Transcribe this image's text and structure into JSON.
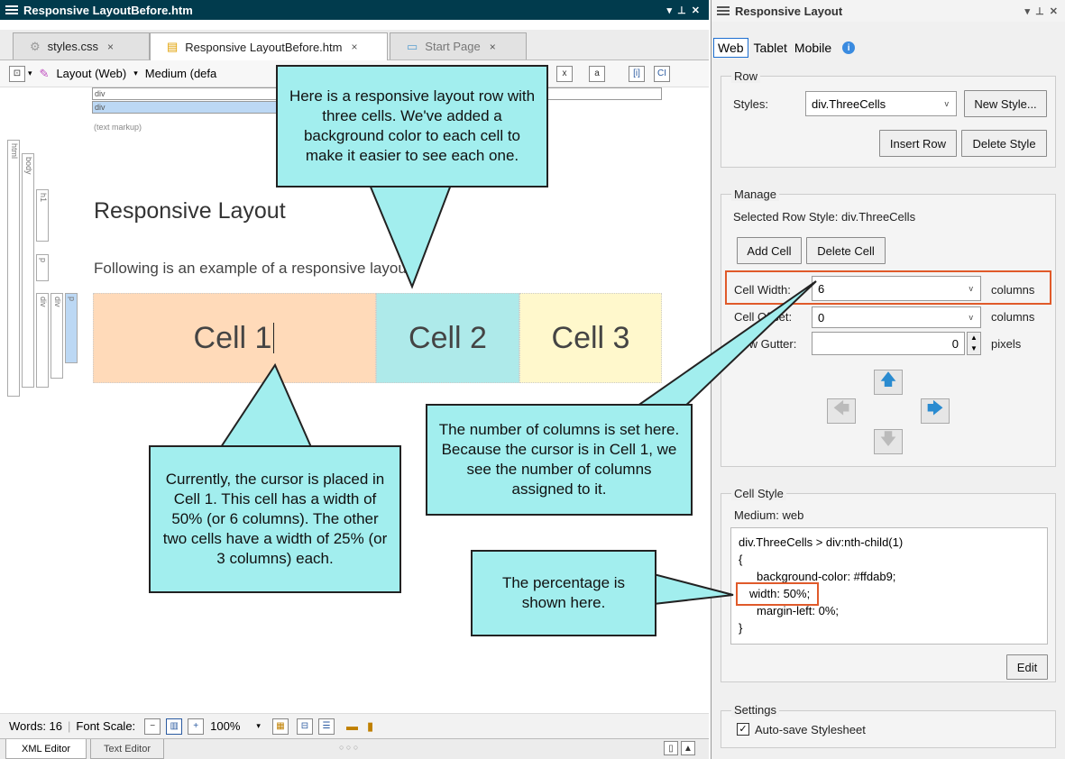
{
  "editor": {
    "title": "Responsive LayoutBefore.htm",
    "tabs": [
      {
        "label": "styles.css",
        "close": "×"
      },
      {
        "label": "Responsive LayoutBefore.htm",
        "close": "×"
      },
      {
        "label": "Start Page",
        "close": "×"
      }
    ],
    "toolbar": {
      "layout_label": "Layout (Web)",
      "medium_label": "Medium (defa"
    },
    "markup": {
      "row1": "div",
      "row2": "div",
      "row3": "(text markup)"
    },
    "vertical_tags": [
      "html",
      "body",
      "h1",
      "p",
      "div",
      "div",
      "p"
    ],
    "heading": "Responsive Layout",
    "paragraph": "Following is an example of a responsive layout.",
    "cells": [
      {
        "label": "Cell 1",
        "color": "#ffdab9"
      },
      {
        "label": "Cell 2",
        "color": "#aeeaea"
      },
      {
        "label": "Cell 3",
        "color": "#fff8cc"
      }
    ],
    "status": {
      "words": "Words: 16",
      "font_scale": "Font Scale:",
      "zoom": "100%"
    },
    "bottom_tabs": [
      "XML Editor",
      "Text Editor"
    ],
    "dots": "○ ○ ○"
  },
  "callouts": {
    "top": "Here is a responsive layout row with three cells. We've added a background color to each cell to make it easier to see each one.",
    "cursor": "Currently, the cursor is placed in Cell 1. This cell has a width of 50% (or 6 columns). The other two cells have a width of 25% (or 3 columns) each.",
    "columns": "The number of columns is set here. Because the cursor is in Cell 1, we see the number of columns assigned to it.",
    "percentage": "The percentage is shown here."
  },
  "panel": {
    "title": "Responsive Layout",
    "tabs": [
      "Web",
      "Tablet",
      "Mobile"
    ],
    "row": {
      "group_label": "Row",
      "styles_label": "Styles:",
      "styles_value": "div.ThreeCells",
      "new_style": "New Style...",
      "insert_row": "Insert Row",
      "delete_style": "Delete Style"
    },
    "manage": {
      "group_label": "Manage",
      "selected_row_style": "Selected Row Style: div.ThreeCells",
      "add_cell": "Add Cell",
      "delete_cell": "Delete Cell",
      "cell_width_label": "Cell Width:",
      "cell_width_value": "6",
      "cell_width_unit": "columns",
      "cell_offset_label": "Cell Offset:",
      "cell_offset_value": "0",
      "cell_offset_unit": "columns",
      "row_gutter_label": "Row Gutter:",
      "row_gutter_value": "0",
      "row_gutter_unit": "pixels"
    },
    "cell_style": {
      "group_label": "Cell Style",
      "medium": "Medium: web",
      "code": [
        "div.ThreeCells > div:nth-child(1)",
        "{",
        "background-color: #ffdab9;",
        "width: 50%;",
        "margin-left: 0%;",
        "}"
      ],
      "edit": "Edit"
    },
    "settings": {
      "group_label": "Settings",
      "autosave": "Auto-save Stylesheet"
    }
  }
}
